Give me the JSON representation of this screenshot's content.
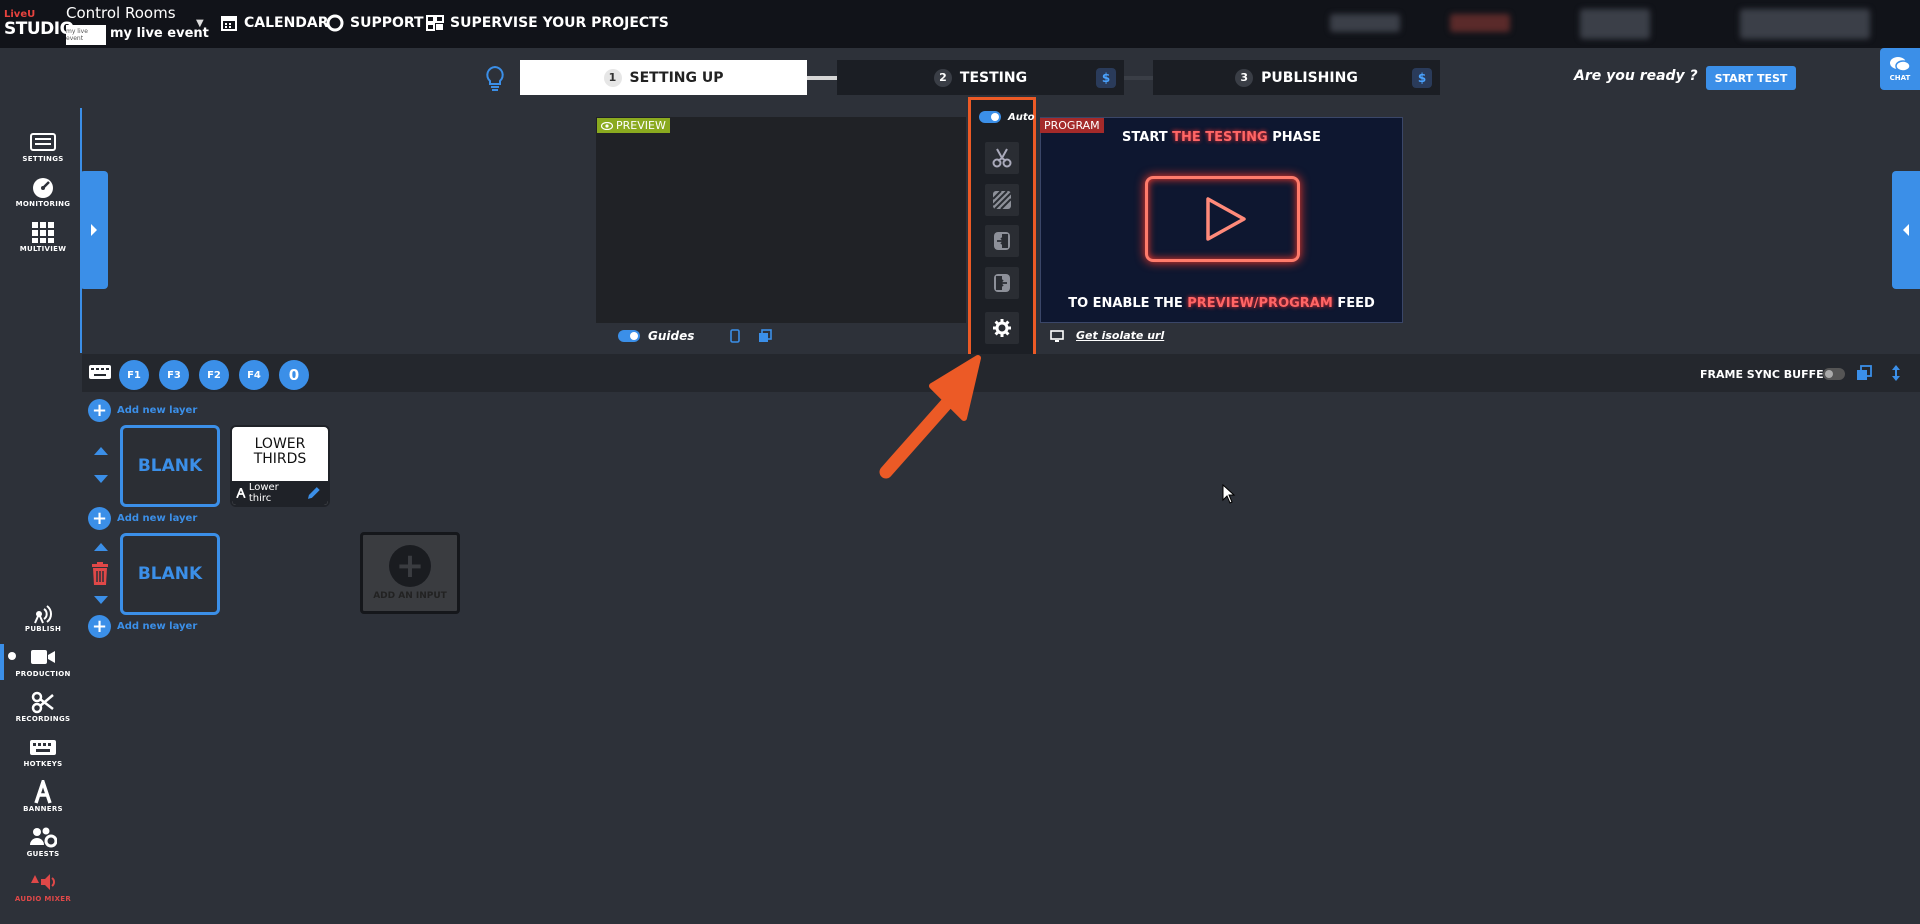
{
  "header": {
    "logo_top": "LiveU",
    "logo_bottom": "STUDIO",
    "room_title": "Control Rooms",
    "event_thumb": "my live event",
    "event_name": "my live event",
    "nav": [
      {
        "label": "CALENDAR",
        "icon": "calendar-icon"
      },
      {
        "label": "SUPPORT",
        "icon": "lifebuoy-icon"
      },
      {
        "label": "SUPERVISE YOUR PROJECTS",
        "icon": "grid-icon"
      }
    ]
  },
  "steps": [
    {
      "num": "1",
      "label": "SETTING UP"
    },
    {
      "num": "2",
      "label": "TESTING",
      "badge": "$"
    },
    {
      "num": "3",
      "label": "PUBLISHING",
      "badge": "$"
    }
  ],
  "ready_text": "Are you ready ?",
  "start_test": "START TEST",
  "chat_label": "CHAT",
  "sidebar_top": [
    {
      "label": "SETTINGS",
      "icon": "settings-icon"
    },
    {
      "label": "MONITORING",
      "icon": "gauge-icon"
    },
    {
      "label": "MULTIVIEW",
      "icon": "multiview-icon"
    }
  ],
  "sidebar_bottom": [
    {
      "label": "PUBLISH",
      "icon": "broadcast-icon"
    },
    {
      "label": "PRODUCTION",
      "icon": "camera-icon",
      "active": true
    },
    {
      "label": "RECORDINGS",
      "icon": "scissors-icon"
    },
    {
      "label": "HOTKEYS",
      "icon": "keyboard-icon"
    },
    {
      "label": "BANNERS",
      "icon": "font-icon"
    },
    {
      "label": "GUESTS",
      "icon": "users-gear-icon"
    },
    {
      "label": "AUDIO MIXER",
      "icon": "speaker-icon"
    }
  ],
  "preview": {
    "tag": "PREVIEW",
    "guides_label": "Guides"
  },
  "transitions": {
    "auto_label": "Auto"
  },
  "program": {
    "tag": "PROGRAM",
    "line1_a": "START ",
    "line1_b": "THE TESTING",
    "line1_c": " PHASE",
    "line2_a": "TO ENABLE THE ",
    "line2_b": "PREVIEW/PROGRAM",
    "line2_c": " FEED",
    "isolate_label": "Get isolate url"
  },
  "hotkeys": [
    "F1",
    "F3",
    "F2",
    "F4",
    "0"
  ],
  "frame_sync_label": "FRAME SYNC BUFFER",
  "layers": {
    "add_layer_label": "Add new layer",
    "blank_label": "BLANK",
    "lower_thirds_title": "LOWER THIRDS",
    "lower_thirds_caption": "Lower thirc",
    "add_input_label": "ADD AN INPUT"
  },
  "colors": {
    "accent": "#3b8fe8",
    "highlight": "#ec5a26",
    "preview_tag": "#8aaa1f",
    "program_tag": "#a42a2a"
  }
}
